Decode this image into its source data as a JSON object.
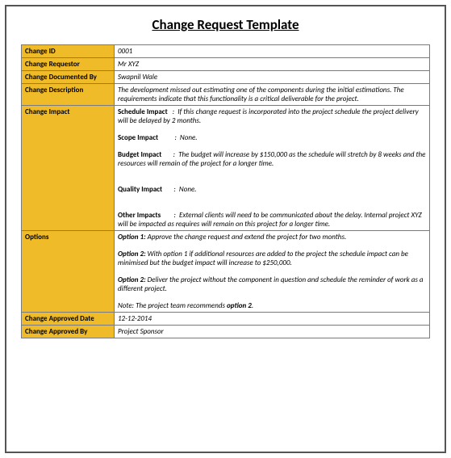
{
  "title": "Change Request Template",
  "rows": {
    "change_id": {
      "label": "Change ID",
      "value": "0001"
    },
    "change_requestor": {
      "label": "Change Requestor",
      "value": "Mr XYZ"
    },
    "change_documented_by": {
      "label": "Change Documented By",
      "value": "Swapnil Wale"
    },
    "change_description": {
      "label": "Change Description",
      "value": "The development missed out estimating one of the components during the initial estimations. The requirements indicate that this functionality is a critical deliverable for the project."
    },
    "change_impact": {
      "label": "Change Impact",
      "impacts": [
        {
          "name": "Schedule Impact",
          "text": "If this change request is incorporated into the project schedule the project delivery will be delayed by 2 months."
        },
        {
          "name": "Scope Impact",
          "text": "None."
        },
        {
          "name": "Budget Impact",
          "text": "The budget will increase by $150,000 as the schedule will stretch by 8 weeks and the resources will remain of the project for a longer time."
        },
        {
          "name": "Quality Impact",
          "text": "None."
        },
        {
          "name": "Other Impacts",
          "text": "External clients will need to be communicated about the delay. Internal project XYZ will be impacted as requires will remain on this project for a longer time."
        }
      ]
    },
    "options": {
      "label": "Options",
      "items": [
        {
          "name": "Option 1:",
          "text": " Approve the change request and extend the project for two months."
        },
        {
          "name": "Option 2:",
          "text": " With option 1 if additional resources are added to the project the schedule impact can be minimised but the budget impact will increase to $250,000."
        },
        {
          "name": "Option 2:",
          "text": " Deliver the project without the component in question and schedule the reminder of work as a different project."
        }
      ],
      "note_prefix": "Note: The project team recommends ",
      "note_bold": "option 2",
      "note_suffix": "."
    },
    "change_approved_date": {
      "label": "Change Approved Date",
      "value": "12-12-2014"
    },
    "change_approved_by": {
      "label": "Change Approved By",
      "value": "Project Sponsor"
    }
  }
}
